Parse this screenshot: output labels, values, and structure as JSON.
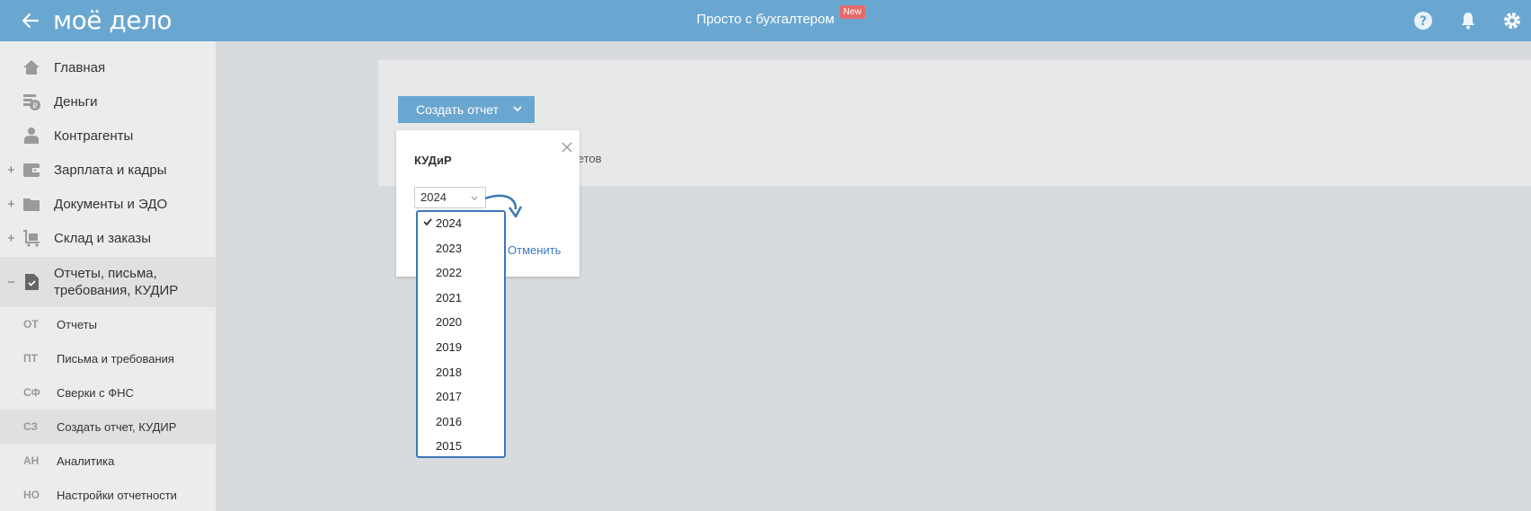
{
  "header": {
    "logo": "моё дело",
    "title": "Просто с бухгалтером",
    "badge": "New",
    "color": "#6aa7d0"
  },
  "sidebar": {
    "items": [
      {
        "label": "Главная",
        "icon": "home-icon",
        "plus": ""
      },
      {
        "label": "Деньги",
        "icon": "money-icon",
        "plus": ""
      },
      {
        "label": "Контрагенты",
        "icon": "contractors-icon",
        "plus": ""
      },
      {
        "label": "Зарплата и кадры",
        "icon": "wallet-icon",
        "plus": "+"
      },
      {
        "label": "Документы и ЭДО",
        "icon": "folder-icon",
        "plus": "+"
      },
      {
        "label": "Склад и заказы",
        "icon": "cart-icon",
        "plus": "+"
      },
      {
        "label_line1": "Отчеты, письма,",
        "label_line2": "требования, КУДИР",
        "icon": "report-icon",
        "plus": "−"
      }
    ],
    "subitems": [
      {
        "abbr": "ОТ",
        "label": "Отчеты"
      },
      {
        "abbr": "ПТ",
        "label": "Письма и требования"
      },
      {
        "abbr": "СФ",
        "label": "Сверки с ФНС"
      },
      {
        "abbr": "СЗ",
        "label": "Создать отчет, КУДИР"
      },
      {
        "abbr": "АН",
        "label": "Аналитика"
      },
      {
        "abbr": "НО",
        "label": "Настройки отчетности"
      }
    ]
  },
  "main": {
    "create_button": "Создать отчет",
    "bg_text": "четов"
  },
  "popup": {
    "title": "КУДиР",
    "selected_year": "2024",
    "cancel": "Отменить",
    "options": [
      "2024",
      "2023",
      "2022",
      "2021",
      "2020",
      "2019",
      "2018",
      "2017",
      "2016",
      "2015"
    ],
    "accent": "#3b79b6"
  }
}
